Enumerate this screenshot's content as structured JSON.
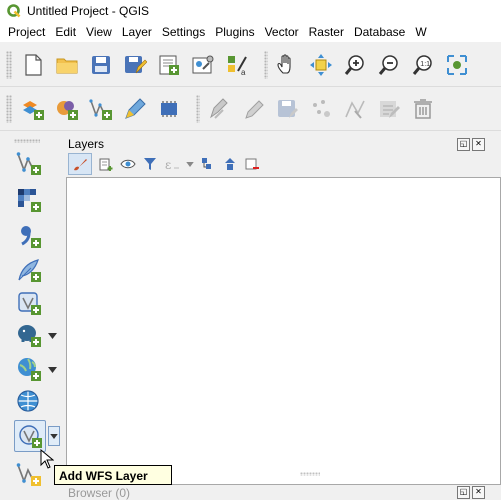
{
  "window": {
    "title": "Untitled Project - QGIS"
  },
  "menubar": {
    "items": [
      "Project",
      "Edit",
      "View",
      "Layer",
      "Settings",
      "Plugins",
      "Vector",
      "Raster",
      "Database",
      "W"
    ]
  },
  "panels": {
    "layers_title": "Layers",
    "browser_title": "Browser (0)"
  },
  "tooltip": {
    "text": "Add WFS Layer"
  },
  "colors": {
    "accent": "#3f8fd2",
    "qgis_green": "#589632",
    "qgis_yellow": "#f0c030"
  }
}
